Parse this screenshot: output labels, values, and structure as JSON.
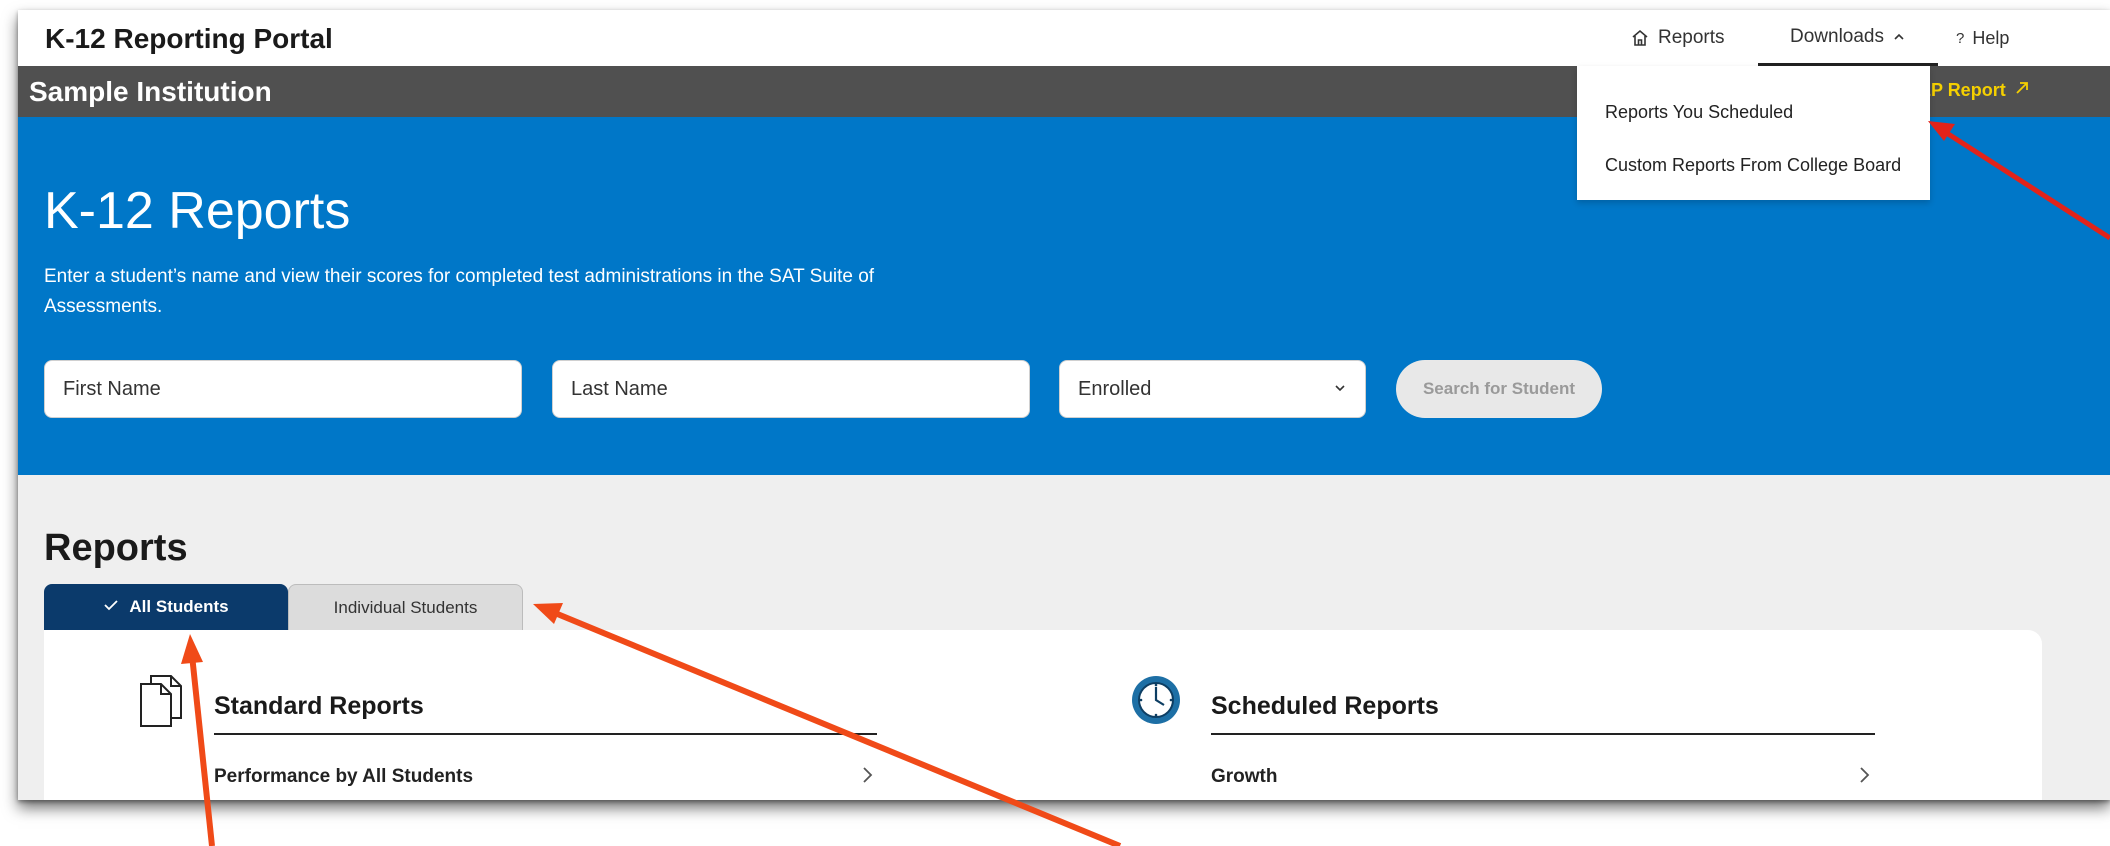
{
  "header": {
    "portal_title": "K-12 Reporting Portal",
    "nav": {
      "reports": "Reports",
      "downloads": "Downloads",
      "help": "Help"
    }
  },
  "institution": {
    "name": "Sample Institution",
    "ep_report_link": "EP Report"
  },
  "downloads_menu": {
    "items": [
      "Reports You Scheduled",
      "Custom Reports From College Board"
    ]
  },
  "hero": {
    "title": "K-12 Reports",
    "description": "Enter a student’s name and view their scores for completed test administrations in the SAT Suite of Assessments.",
    "first_name_placeholder": "First Name",
    "last_name_placeholder": "Last Name",
    "status_select": "Enrolled",
    "search_button": "Search for Student"
  },
  "reports": {
    "heading": "Reports",
    "tabs": [
      {
        "label": "All Students",
        "selected": true
      },
      {
        "label": "Individual Students",
        "selected": false
      }
    ],
    "standard": {
      "title": "Standard Reports",
      "first_link": "Performance by All Students"
    },
    "scheduled": {
      "title": "Scheduled Reports",
      "first_link": "Growth"
    }
  },
  "colors": {
    "hero_blue": "#0077c8",
    "institution_bar": "#505050",
    "tab_selected": "#0b3a6b",
    "ep_link": "#f5d000",
    "annotation_arrow": "#f04a18"
  },
  "icons": [
    "home-icon",
    "chevron-up-icon",
    "question-icon",
    "external-link-icon",
    "chevron-down-icon",
    "check-icon",
    "documents-icon",
    "clock-icon",
    "chevron-right-icon"
  ]
}
